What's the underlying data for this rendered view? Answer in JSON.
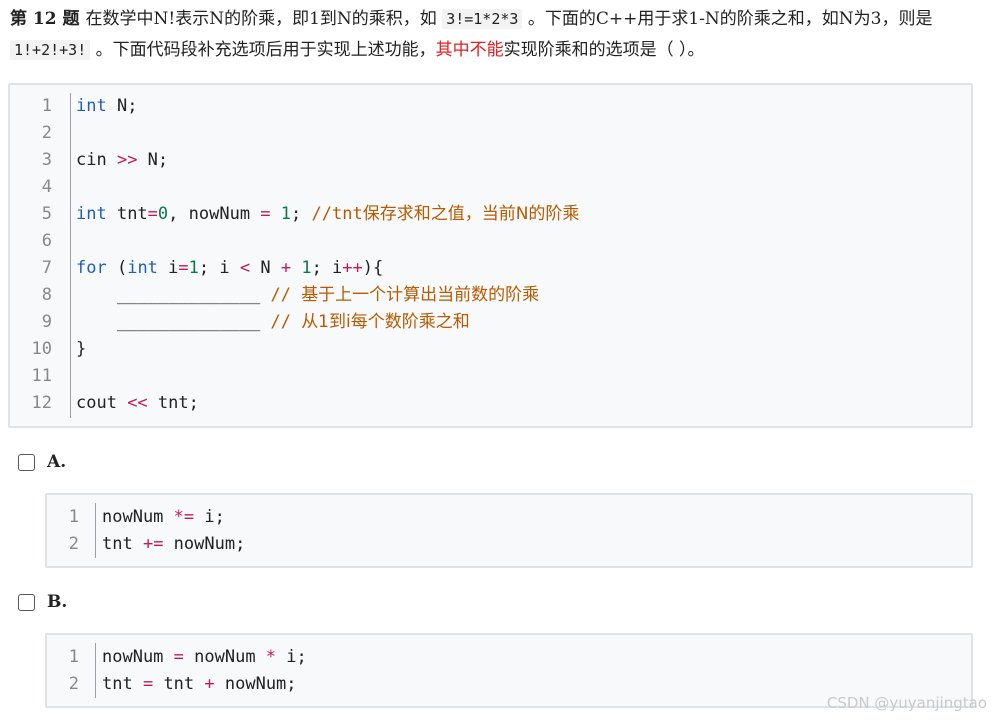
{
  "question": {
    "number": "第 12 题",
    "p1": "在数学中N!表示N的阶乘，即1到N的乘积，如 ",
    "c1": "3!=1*2*3",
    "p2": " 。下面的C++用于求1-N的阶乘之和，如N为3，则是 ",
    "c2": "1!+2!+3!",
    "p3": " 。下面代码段补充选项后用于实现上述功能，",
    "highlight": "其中不能",
    "p4": "实现阶乘和的选项是（    ）。"
  },
  "main_code": {
    "line_numbers": [
      "1",
      "2",
      "3",
      "4",
      "5",
      "6",
      "7",
      "8",
      "9",
      "10",
      "11",
      "12"
    ],
    "l1_kw": "int",
    "l1_rest": " N;",
    "l3_a": "cin ",
    "l3_op": ">>",
    "l3_b": " N;",
    "l5_kw": "int",
    "l5_a": " tnt",
    "l5_eq": "=",
    "l5_zero": "0",
    "l5_b": ", nowNum ",
    "l5_eq2": "=",
    "l5_sp": " ",
    "l5_one": "1",
    "l5_c": "; ",
    "l5_cm": "//tnt",
    "l5_cmz": "保存求和之值，当前N的阶乘",
    "l7_for": "for",
    "l7_a": " (",
    "l7_int": "int",
    "l7_b": " i",
    "l7_eq": "=",
    "l7_one": "1",
    "l7_c": "; i ",
    "l7_lt": "<",
    "l7_d": " N ",
    "l7_plus": "+",
    "l7_e": " ",
    "l7_one2": "1",
    "l7_f": "; i",
    "l7_pp": "++",
    "l7_g": "){",
    "l8_blank": "    ______________ ",
    "l8_cm": "// ",
    "l8_cmz": "基于上一个计算出当前数的阶乘",
    "l9_blank": "    ______________ ",
    "l9_cm": "// ",
    "l9_cmz": "从1到i每个数阶乘之和",
    "l10": "}",
    "l12_a": "cout ",
    "l12_op": "<<",
    "l12_b": " tnt;"
  },
  "options": [
    {
      "label": "A.",
      "line_numbers": [
        "1",
        "2"
      ],
      "l1_a": "nowNum ",
      "l1_op": "*=",
      "l1_b": " i;",
      "l2_a": "tnt ",
      "l2_op": "+=",
      "l2_b": " nowNum;"
    },
    {
      "label": "B.",
      "line_numbers": [
        "1",
        "2"
      ],
      "l1_a": "nowNum ",
      "l1_op": "=",
      "l1_b": " nowNum ",
      "l1_op2": "*",
      "l1_c": " i;",
      "l2_a": "tnt ",
      "l2_op": "=",
      "l2_b": " tnt ",
      "l2_op2": "+",
      "l2_c": " nowNum;"
    }
  ],
  "watermark": "CSDN @yuyanjingtao",
  "colors": {
    "keyword": "#1f5fb8",
    "operator": "#c2185b",
    "number": "#0a7a4a",
    "comment": "#b85a00",
    "highlight": "#e02020"
  }
}
